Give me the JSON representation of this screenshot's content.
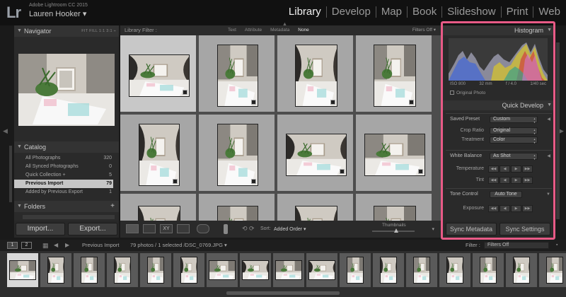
{
  "app": {
    "logo": "Lr",
    "title": "Adobe Lightroom CC 2015",
    "user": "Lauren Hooker ▾"
  },
  "modules": [
    "Library",
    "Develop",
    "Map",
    "Book",
    "Slideshow",
    "Print",
    "Web"
  ],
  "active_module": "Library",
  "left_panel": {
    "navigator": {
      "title": "Navigator",
      "options": "FIT  FILL  1:1  3:1 ÷"
    },
    "catalog": {
      "title": "Catalog",
      "items": [
        {
          "label": "All Photographs",
          "count": "320"
        },
        {
          "label": "All Synced Photographs",
          "count": "0"
        },
        {
          "label": "Quick Collection +",
          "count": "5"
        },
        {
          "label": "Previous Import",
          "count": "79"
        },
        {
          "label": "Added by Previous Export",
          "count": "1"
        }
      ],
      "selected_index": 3
    },
    "folders": {
      "title": "Folders",
      "add": "+"
    },
    "buttons": {
      "import": "Import...",
      "export": "Export..."
    }
  },
  "grid_header": {
    "label": "Library Filter :",
    "options": [
      "Text",
      "Attribute",
      "Metadata",
      "None"
    ],
    "active_option": "None",
    "filters_status": "Filters Off ▾"
  },
  "toolbar": {
    "sort_label": "Sort:",
    "sort_value": "Added Order ▾",
    "thumbnails_label": "Thumbnails"
  },
  "right_panel": {
    "histogram": {
      "title": "Histogram",
      "iso": "ISO 800",
      "focal": "32 mm",
      "aperture": "f / 4.0",
      "shutter": "1/40 sec",
      "original_photo": "Original Photo"
    },
    "quick_develop": {
      "title": "Quick Develop",
      "saved_preset_label": "Saved Preset",
      "saved_preset_value": "Custom",
      "crop_ratio_label": "Crop Ratio",
      "crop_ratio_value": "Original",
      "treatment_label": "Treatment",
      "treatment_value": "Color",
      "white_balance_label": "White Balance",
      "white_balance_value": "As Shot",
      "temperature_label": "Temperature",
      "tint_label": "Tint",
      "tone_control_label": "Tone Control",
      "auto_tone": "Auto Tone",
      "exposure_label": "Exposure"
    },
    "buttons": {
      "sync_metadata": "Sync Metadata",
      "sync_settings": "Sync Settings"
    }
  },
  "filmstrip_bar": {
    "screen1": "1",
    "screen2": "2",
    "source": "Previous Import",
    "count_text": "79 photos / 1 selected /DSC_0769.JPG ▾",
    "filter_label": "Filter :",
    "filter_value": "Filters Off"
  },
  "colors": {
    "highlight": "#e85a86",
    "selected_cell": "#c8c8c8",
    "grid_bg": "#a6a6a6"
  }
}
